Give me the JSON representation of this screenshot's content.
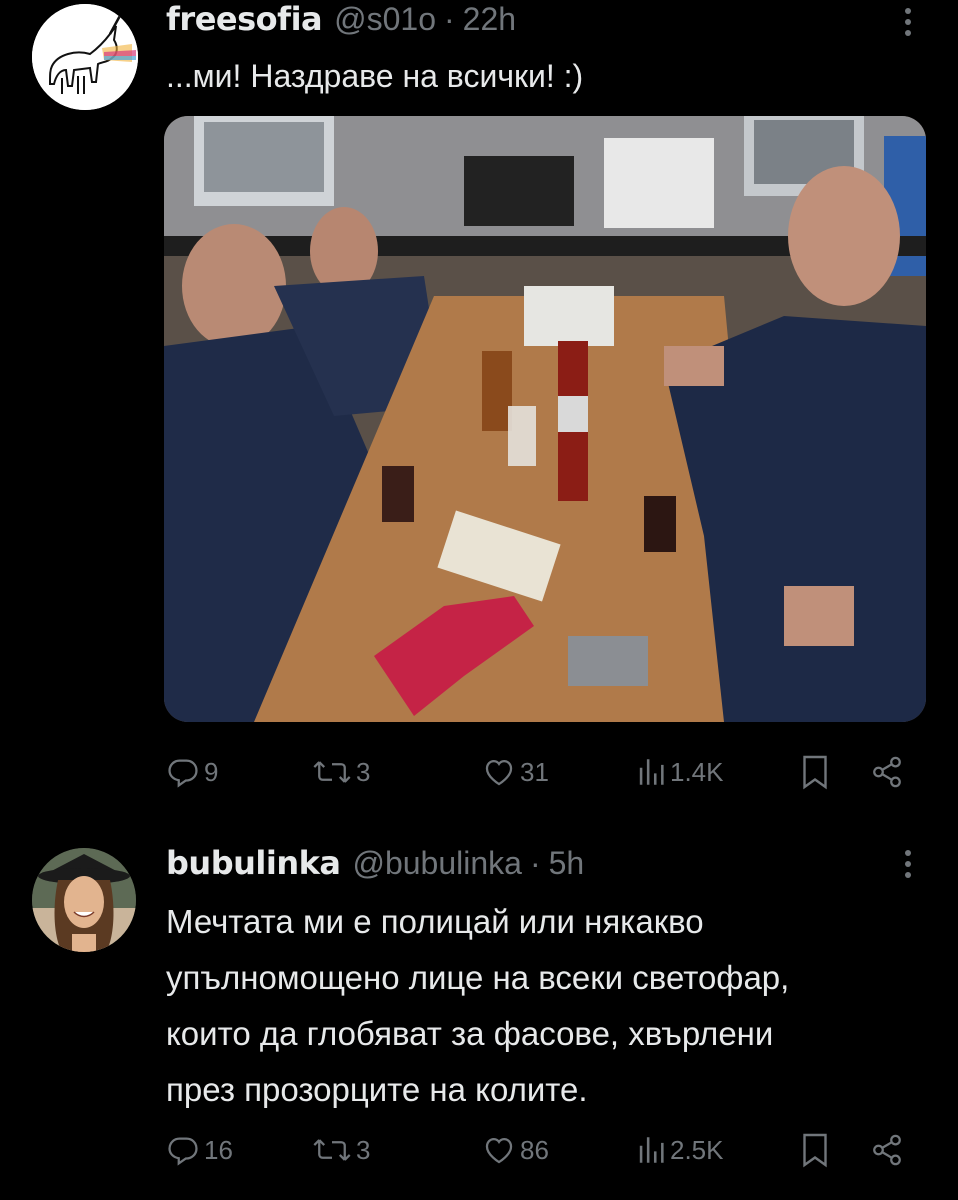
{
  "posts": [
    {
      "display_name": "freesofia",
      "handle": "@s01o",
      "separator": "·",
      "time": "22h",
      "text_lines": [
        "...ми! Наздраве на всички! :)"
      ],
      "has_media": true,
      "media_alt": "",
      "stats": {
        "replies": "9",
        "reposts": "3",
        "likes": "31",
        "views": "1.4K"
      }
    },
    {
      "display_name": "bubulinka",
      "handle": "@bubulinka",
      "separator": "·",
      "time": "5h",
      "text_lines": [
        "Мечтата ми е полицай или някакво",
        "упълномощено лице на всеки светофар,",
        "които да глобяват за фасове, хвърлени",
        "през прозорците на колите."
      ],
      "has_media": false,
      "stats": {
        "replies": "16",
        "reposts": "3",
        "likes": "86",
        "views": "2.5K"
      }
    }
  ],
  "colors": {
    "background": "#000000",
    "primary_text": "#e7e9ea",
    "secondary_text": "#71767b"
  },
  "icons": [
    "reply-icon",
    "repost-icon",
    "like-icon",
    "views-icon",
    "bookmark-icon",
    "share-icon",
    "more-icon"
  ]
}
